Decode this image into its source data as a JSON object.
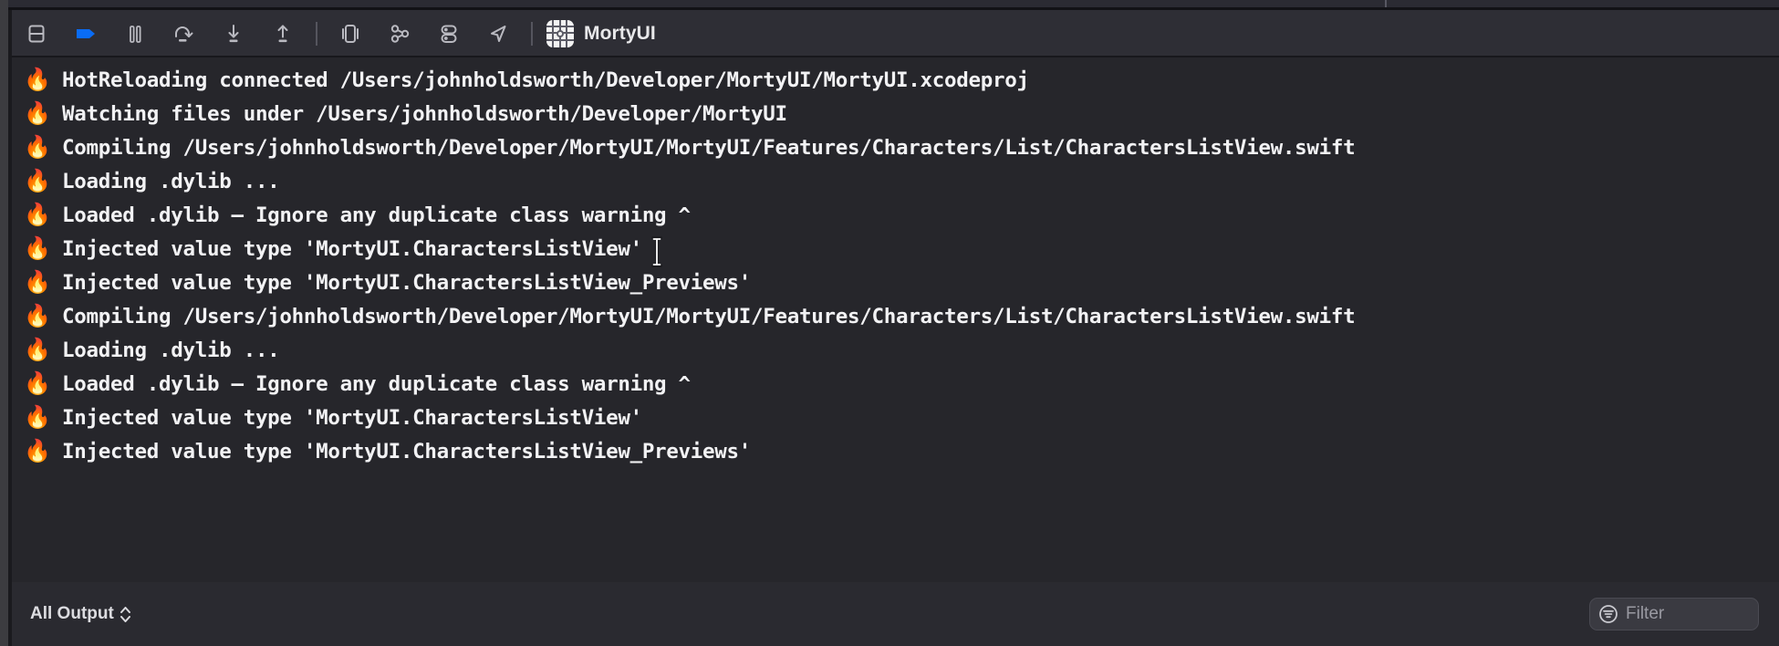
{
  "window": {
    "app_title": "MortyUI",
    "app_icon": "app-grid-icon"
  },
  "toolbar": {
    "buttons": [
      {
        "name": "toggle-console-pane-button",
        "icon": "rectangle-split-horizontal-icon",
        "label": "Hide/Show Console",
        "active": false
      },
      {
        "name": "continue-program-button",
        "icon": "continue-arrow-icon",
        "label": "Continue",
        "active": true
      },
      {
        "name": "pause-program-button",
        "icon": "pause-icon",
        "label": "Pause",
        "active": false
      },
      {
        "name": "step-over-button",
        "icon": "step-over-icon",
        "label": "Step Over",
        "active": false
      },
      {
        "name": "step-into-button",
        "icon": "step-into-icon",
        "label": "Step Into",
        "active": false
      },
      {
        "name": "step-out-button",
        "icon": "step-out-icon",
        "label": "Step Out",
        "active": false
      },
      {
        "name": "view-debugging-button",
        "icon": "view-hierarchy-icon",
        "label": "Debug View Hierarchy",
        "active": false
      },
      {
        "name": "memory-graph-button",
        "icon": "memory-graph-icon",
        "label": "Debug Memory Graph",
        "active": false
      },
      {
        "name": "environment-overrides-button",
        "icon": "environment-toggles-icon",
        "label": "Environment Overrides",
        "active": false
      },
      {
        "name": "simulate-location-button",
        "icon": "location-arrow-icon",
        "label": "Simulate Location",
        "active": false
      }
    ]
  },
  "console": {
    "emoji": "🔥",
    "lines": [
      "HotReloading connected /Users/johnholdsworth/Developer/MortyUI/MortyUI.xcodeproj",
      "Watching files under /Users/johnholdsworth/Developer/MortyUI",
      "Compiling /Users/johnholdsworth/Developer/MortyUI/MortyUI/Features/Characters/List/CharactersListView.swift",
      "Loading .dylib ...",
      "Loaded .dylib — Ignore any duplicate class warning ^",
      "Injected value type 'MortyUI.CharactersListView'",
      "Injected value type 'MortyUI.CharactersListView_Previews'",
      "Compiling /Users/johnholdsworth/Developer/MortyUI/MortyUI/Features/Characters/List/CharactersListView.swift",
      "Loading .dylib ...",
      "Loaded .dylib — Ignore any duplicate class warning ^",
      "Injected value type 'MortyUI.CharactersListView'",
      "Injected value type 'MortyUI.CharactersListView_Previews'"
    ]
  },
  "statusbar": {
    "output_scope_label": "All Output",
    "filter_placeholder": "Filter",
    "filter_value": "",
    "filter_icon": "filter-circle-icon"
  },
  "colors": {
    "accent_blue": "#0a6cf5",
    "console_background": "#26262b",
    "toolbar_background": "#2e2e35",
    "statusbar_background": "#2a2a30",
    "text_primary": "#f2f2f4",
    "text_secondary": "#9a9aa2",
    "icon_stroke": "#b9b9c0"
  }
}
